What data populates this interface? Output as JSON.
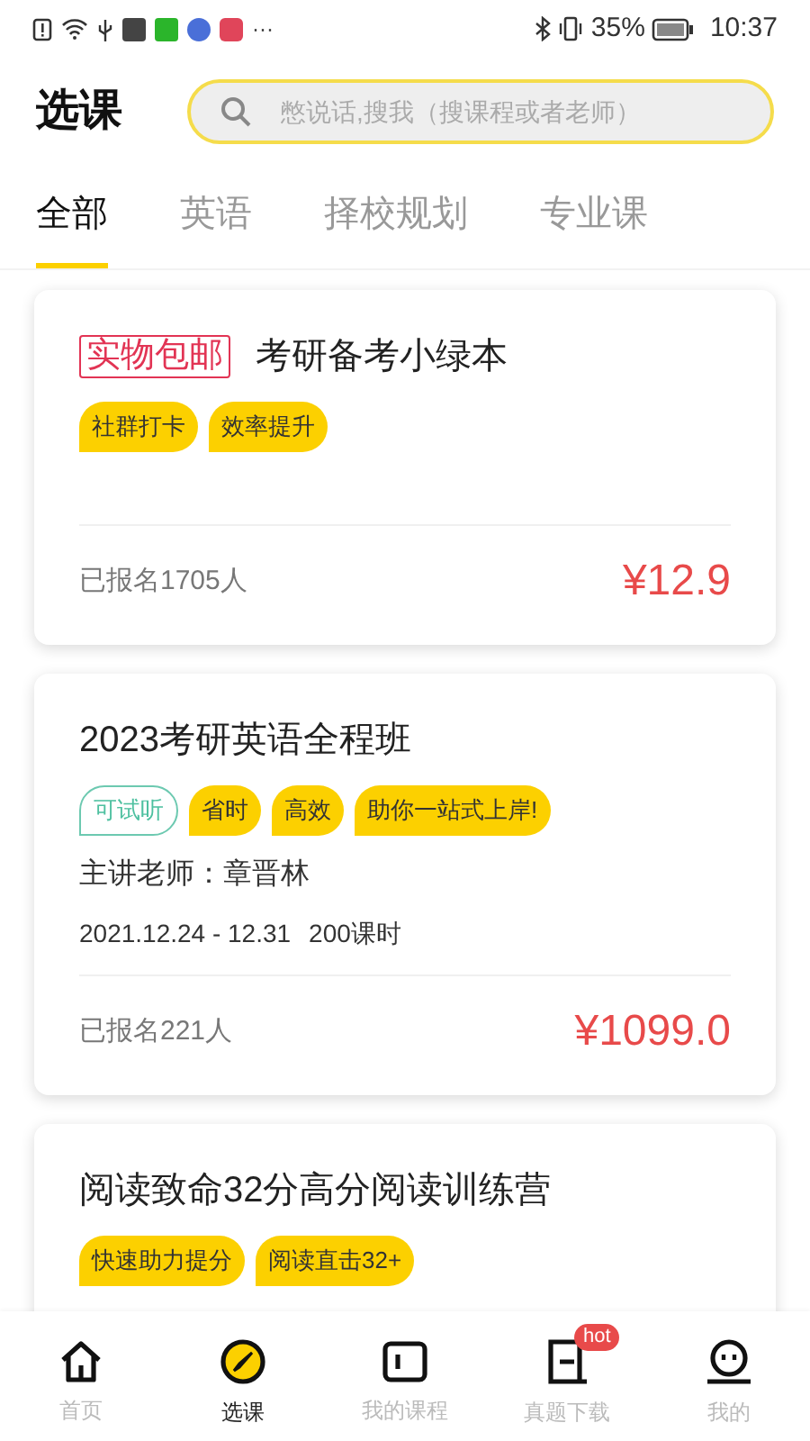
{
  "status_bar": {
    "overflow": "···",
    "battery": "35%",
    "time": "10:37"
  },
  "header": {
    "title": "选课",
    "search": {
      "placeholder": "憋说话,搜我（搜课程或者老师）"
    }
  },
  "tabs": [
    {
      "label": "全部",
      "selected": true
    },
    {
      "label": "英语",
      "selected": false
    },
    {
      "label": "择校规划",
      "selected": false
    },
    {
      "label": "专业课",
      "selected": false
    }
  ],
  "courses": [
    {
      "badge": "实物包邮",
      "title": "考研备考小绿本",
      "tags": [
        {
          "kind": "highlight",
          "label": "社群打卡"
        },
        {
          "kind": "highlight",
          "label": "效率提升"
        }
      ],
      "enrolled": "已报名1705人",
      "price": "¥12.9"
    },
    {
      "title": "2023考研英语全程班",
      "tags": [
        {
          "kind": "trial",
          "label": "可试听"
        },
        {
          "kind": "highlight",
          "label": "省时"
        },
        {
          "kind": "highlight",
          "label": "高效"
        },
        {
          "kind": "highlight",
          "label": "助你一站式上岸!"
        }
      ],
      "teacher": "主讲老师：章晋林",
      "schedule": "2021.12.24 - 12.31",
      "hours": "200课时",
      "enrolled": "已报名221人",
      "price": "¥1099.0"
    },
    {
      "title": "阅读致命32分高分阅读训练营",
      "tags": [
        {
          "kind": "highlight",
          "label": "快速助力提分"
        },
        {
          "kind": "highlight",
          "label": "阅读直击32+"
        }
      ]
    }
  ],
  "nav": [
    {
      "kind": "home",
      "label": "首页",
      "selected": false
    },
    {
      "kind": "compass",
      "label": "选课",
      "selected": true
    },
    {
      "kind": "course",
      "label": "我的课程",
      "selected": false
    },
    {
      "kind": "download",
      "label": "真题下载",
      "selected": false,
      "badge": "hot"
    },
    {
      "kind": "profile",
      "label": "我的",
      "selected": false
    }
  ]
}
